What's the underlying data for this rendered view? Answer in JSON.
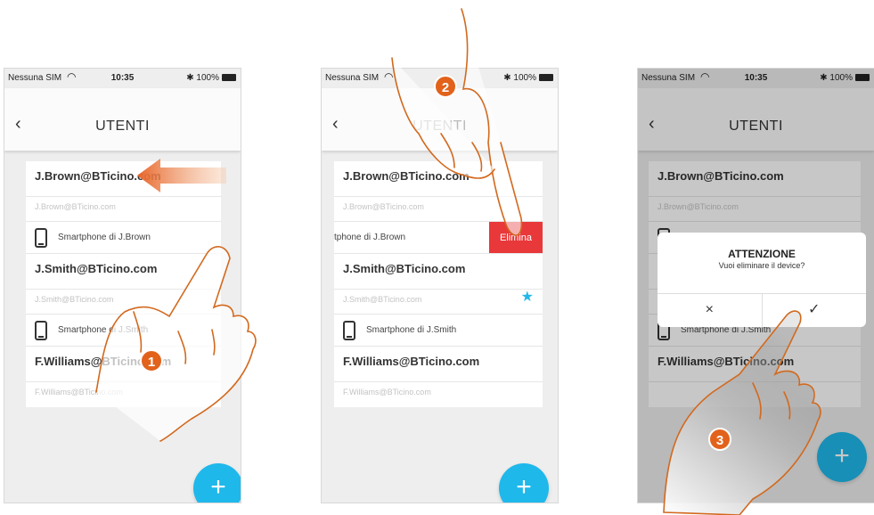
{
  "status": {
    "carrier": "Nessuna SIM",
    "time": "10:35",
    "battery": "100%"
  },
  "screen": {
    "back_icon": "chevron-left-icon",
    "title": "UTENTI"
  },
  "users": [
    {
      "email": "J.Brown@BTicino.com",
      "sub": "J.Brown@BTicino.com",
      "device": "Smartphone di J.Brown",
      "device_cut": "tphone di J.Brown"
    },
    {
      "email": "J.Smith@BTicino.com",
      "sub": "J.Smith@BTicino.com",
      "device": "Smartphone di J.Smith"
    },
    {
      "email": "F.Williams@BTicino.com",
      "sub": "F.Williams@BTicino.com"
    }
  ],
  "actions": {
    "delete_label": "Elimina",
    "add_label": "+"
  },
  "dialog": {
    "title": "ATTENZIONE",
    "message": "Vuoi eliminare il device?",
    "cancel": "×",
    "confirm": "✓"
  },
  "steps": [
    "1",
    "2",
    "3"
  ],
  "colors": {
    "accent": "#1fb8ea",
    "danger": "#e8383a",
    "badge": "#e2621b",
    "hand_outline": "#d2691e"
  }
}
